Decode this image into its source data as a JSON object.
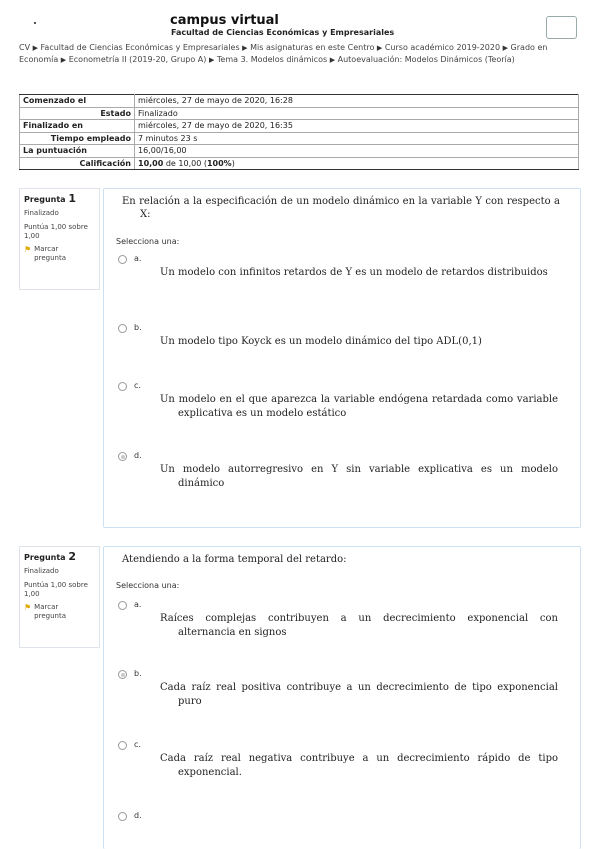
{
  "header": {
    "site_title": "campus virtual",
    "site_subtitle": "Facultad de Ciencias Económicas y Empresariales"
  },
  "breadcrumb": [
    "CV",
    "Facultad de Ciencias Económicas y Empresariales",
    "Mis asignaturas en este Centro",
    "Curso académico 2019-2020",
    "Grado en Economía",
    "Econometría II (2019-20, Grupo A)",
    "Tema 3. Modelos dinámicos",
    "Autoevaluación: Modelos Dinámicos (Teoría)"
  ],
  "summary": [
    {
      "label": "Comenzado el",
      "value": "miércoles, 27 de mayo de 2020, 16:28"
    },
    {
      "label": "Estado",
      "value": "Finalizado"
    },
    {
      "label": "Finalizado en",
      "value": "miércoles, 27 de mayo de 2020, 16:35"
    },
    {
      "label": "Tiempo empleado",
      "value": "7 minutos 23 s"
    },
    {
      "label": "La puntuación",
      "value": "16,00/16,00"
    },
    {
      "label": "Calificación",
      "value_bold": "10,00",
      "value_mid": " de 10,00 (",
      "value_pct": "100%",
      "value_end": ")"
    }
  ],
  "questions": [
    {
      "label": "Pregunta",
      "number": "1",
      "state": "Finalizado",
      "grade": "Puntúa 1,00 sobre 1,00",
      "flag": "Marcar pregunta",
      "text": "En relación a la especificación de un modelo dinámico en la variable Y con respecto a X:",
      "prompt": "Selecciona una:",
      "options": [
        {
          "letter": "a.",
          "text": "Un modelo con infinitos retardos de Y es un modelo de retardos distribuidos",
          "selected": false
        },
        {
          "letter": "b.",
          "text": "Un modelo tipo Koyck es un modelo dinámico del tipo ADL(0,1)",
          "selected": false
        },
        {
          "letter": "c.",
          "text": "Un modelo en el que aparezca la variable endógena retardada como variable explicativa es un modelo estático",
          "selected": false
        },
        {
          "letter": "d.",
          "text": "Un modelo autorregresivo en Y sin variable explicativa es un modelo dinámico",
          "selected": true
        }
      ]
    },
    {
      "label": "Pregunta",
      "number": "2",
      "state": "Finalizado",
      "grade": "Puntúa 1,00 sobre 1,00",
      "flag": "Marcar pregunta",
      "text": "Atendiendo a la forma temporal del retardo:",
      "prompt": "Selecciona una:",
      "options": [
        {
          "letter": "a.",
          "text": "Raíces complejas contribuyen a un decrecimiento exponencial con alternancia en signos",
          "selected": false
        },
        {
          "letter": "b.",
          "text": "Cada raíz real positiva contribuye a un decrecimiento de tipo exponencial puro",
          "selected": true
        },
        {
          "letter": "c.",
          "text": "Cada raíz real negativa contribuye a un decrecimiento rápido de tipo exponencial.",
          "selected": false
        },
        {
          "letter": "d.",
          "text": "",
          "selected": false
        }
      ]
    }
  ],
  "colors": {
    "flag": "#e0a800",
    "box_border": "#cde1f2"
  }
}
